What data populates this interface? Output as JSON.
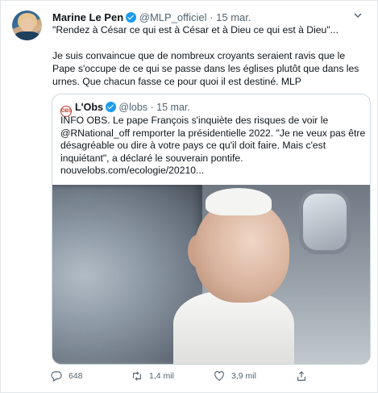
{
  "tweet": {
    "author_name": "Marine Le Pen",
    "author_handle": "@MLP_officiel",
    "separator": "·",
    "date": "15 mar.",
    "line1": "\"Rendez à César ce qui est à César et à Dieu ce qui est à Dieu\"...",
    "line2": "Je suis convaincue que de nombreux croyants seraient ravis que le Pape s'occupe de ce qui se passe dans les églises plutôt que dans les urnes. Que chacun fasse ce pour quoi il est destiné. MLP",
    "more_icon": "chevron-down-icon"
  },
  "quoted": {
    "logo_text": "OBS",
    "author_name": "L'Obs",
    "author_handle": "@lobs",
    "separator": "·",
    "date": "15 mar.",
    "text": "INFO OBS. Le pape François s'inquiète des risques de voir le @RNational_off remporter la présidentielle 2022. \"Je ne veux pas être désagréable ou dire à votre pays ce qu'il doit faire. Mais c'est inquiétant\", a déclaré le souverain pontife.",
    "link": "nouvelobs.com/ecologie/20210..."
  },
  "actions": {
    "reply_count": "648",
    "retweet_count": "1,4 mil",
    "like_count": "3,9 mil"
  },
  "colors": {
    "verified": "#1d9bf0",
    "muted": "#536471",
    "border": "#cfd9de"
  }
}
